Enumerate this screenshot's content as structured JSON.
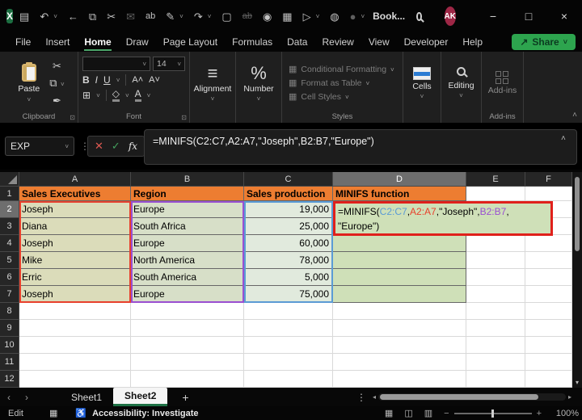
{
  "titlebar": {
    "title": "Book...",
    "avatar": "AK",
    "minimize": "−",
    "maximize": "□",
    "close": "×",
    "icons": {
      "logo": "X",
      "save": "▤",
      "undo": "↶",
      "back": "←",
      "copy": "⧉",
      "cut": "✂",
      "mail": "✉",
      "replace": "ab",
      "draw": "✎",
      "redo": "↷",
      "newdoc": "▢",
      "strike": "ab",
      "camera": "◉",
      "tablesearch": "▦",
      "docplay": "▷",
      "lockuser": "◍",
      "moon": "●",
      "chev": "˅"
    }
  },
  "ribbon_tabs": {
    "items": [
      "File",
      "Insert",
      "Home",
      "Draw",
      "Page Layout",
      "Formulas",
      "Data",
      "Review",
      "View",
      "Developer",
      "Help"
    ],
    "share": "Share"
  },
  "ribbon": {
    "paste": "Paste",
    "clipboard_label": "Clipboard",
    "font_label": "Font",
    "font_size": "14",
    "bold": "B",
    "italic": "I",
    "underline": "U",
    "grow": "A˄",
    "shrink": "A˅",
    "borders_icon": "⊞",
    "fill_icon": "◇",
    "fontcolor_icon": "A",
    "alignment": "Alignment",
    "alignment_icon": "≡",
    "number": "Number",
    "percent": "%",
    "styles": {
      "conditional": "Conditional Formatting",
      "format_table": "Format as Table",
      "cell_styles": "Cell Styles",
      "label": "Styles"
    },
    "cells": "Cells",
    "editing": "Editing",
    "addins": "Add-ins",
    "collapse": "˄"
  },
  "formula_bar": {
    "name_box": "EXP",
    "cancel": "✕",
    "enter": "✓",
    "fx": "fx",
    "formula": "=MINIFS(C2:C7,A2:A7,\"Joseph\",B2:B7,\"Europe\")",
    "expand": "˄"
  },
  "sheet": {
    "col_headers": [
      "A",
      "B",
      "C",
      "D",
      "E",
      "F"
    ],
    "row_headers": [
      "1",
      "2",
      "3",
      "4",
      "5",
      "6",
      "7",
      "8",
      "9",
      "10",
      "11",
      "12"
    ],
    "header_row": {
      "a": "Sales Executives",
      "b": "Region",
      "c": "Sales production",
      "d": "MINIFS function"
    },
    "rows": [
      {
        "name": "Joseph",
        "region": "Europe",
        "sales": "19,000"
      },
      {
        "name": "Diana",
        "region": "South Africa",
        "sales": "25,000"
      },
      {
        "name": "Joseph",
        "region": "Europe",
        "sales": "60,000"
      },
      {
        "name": "Mike",
        "region": "North America",
        "sales": "78,000"
      },
      {
        "name": "Erric",
        "region": "South America",
        "sales": "5,000"
      },
      {
        "name": "Joseph",
        "region": "Europe",
        "sales": "75,000"
      }
    ],
    "active_formula": {
      "p1": "=MINIFS(",
      "ref1": "C2:C7",
      "c1": ",",
      "ref2": "A2:A7",
      "p2": ",\"Joseph\",",
      "ref3": "B2:B7",
      "c2": ",",
      "line2": "\"Europe\")"
    }
  },
  "sheet_tabs": {
    "prev": "‹",
    "next": "›",
    "sheet1": "Sheet1",
    "sheet2": "Sheet2",
    "add": "+"
  },
  "status_bar": {
    "mode": "Edit",
    "accessibility": "Accessibility: Investigate",
    "zoom": "100%"
  },
  "colors": {
    "header_fill": "#ED7D31",
    "col_a_fill": "#dbdcba",
    "col_b_fill": "#d7dfc8",
    "col_c_fill": "#e1eadd",
    "col_d_fill": "#cfe0b8",
    "ref_blue": "#5b9bd5",
    "ref_red": "#e8402c",
    "ref_purple": "#9a4fd1",
    "annotation_red": "#e0201b",
    "excel_green": "#2da44e",
    "tab_underline_green": "#1e7145"
  }
}
